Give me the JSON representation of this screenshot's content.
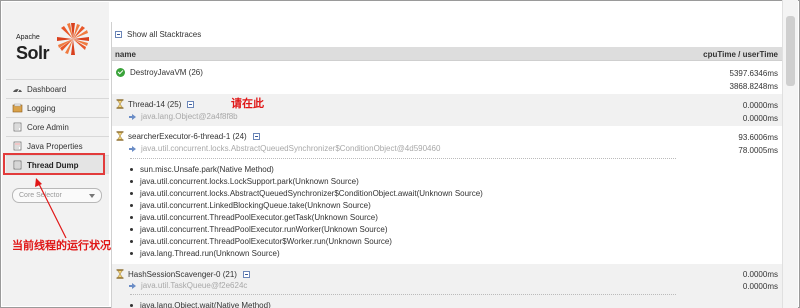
{
  "logo": {
    "apache": "Apache",
    "solr": "Solr"
  },
  "nav": {
    "items": [
      {
        "label": "Dashboard",
        "icon": "dashboard-icon"
      },
      {
        "label": "Logging",
        "icon": "logging-icon"
      },
      {
        "label": "Core Admin",
        "icon": "core-admin-icon"
      },
      {
        "label": "Java Properties",
        "icon": "java-properties-icon"
      },
      {
        "label": "Thread Dump",
        "icon": "thread-dump-icon",
        "active": true
      }
    ],
    "core_selector_placeholder": "Core Selector"
  },
  "annotations": {
    "current_thread_state": "当前线程的运行状况",
    "click_here": "请在此"
  },
  "main": {
    "show_all_label": "Show all Stacktraces",
    "columns": {
      "name": "name",
      "times": "cpuTime / userTime"
    },
    "threads": [
      {
        "name": "DestroyJavaVM (26)",
        "status": "runnable",
        "lock": "",
        "cpu": "5397.6346ms",
        "user": "3868.8248ms"
      },
      {
        "name": "Thread-14 (25)",
        "status": "waiting",
        "lock": "java.lang.Object@2a4f8f8b",
        "cpu": "0.0000ms",
        "user": "0.0000ms"
      },
      {
        "name": "searcherExecutor-6-thread-1 (24)",
        "status": "waiting",
        "lock": "java.util.concurrent.locks.AbstractQueuedSynchronizer$ConditionObject@4d590460",
        "cpu": "93.6006ms",
        "user": "78.0005ms",
        "stacktrace": [
          "sun.misc.Unsafe.park(Native Method)",
          "java.util.concurrent.locks.LockSupport.park(Unknown Source)",
          "java.util.concurrent.locks.AbstractQueuedSynchronizer$ConditionObject.await(Unknown Source)",
          "java.util.concurrent.LinkedBlockingQueue.take(Unknown Source)",
          "java.util.concurrent.ThreadPoolExecutor.getTask(Unknown Source)",
          "java.util.concurrent.ThreadPoolExecutor.runWorker(Unknown Source)",
          "java.util.concurrent.ThreadPoolExecutor$Worker.run(Unknown Source)",
          "java.lang.Thread.run(Unknown Source)"
        ]
      },
      {
        "name": "HashSessionScavenger-0 (21)",
        "status": "waiting",
        "lock": "java.util.TaskQueue@f2e624c",
        "cpu": "0.0000ms",
        "user": "0.0000ms",
        "stacktrace_partial": "java.lang.Object.wait(Native Method)"
      }
    ]
  },
  "colors": {
    "annotation_red": "#e01616",
    "active_border": "#e23b3b",
    "runnable_green": "#3aa33a",
    "lock_blue": "#6b8dc6"
  }
}
